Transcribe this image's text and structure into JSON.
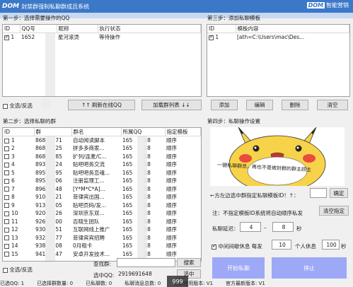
{
  "window": {
    "logo": "DOM",
    "title": "封禁群强制私聊群成员系统",
    "brand_box": "DOM",
    "brand_text": "智能营销"
  },
  "step1": {
    "title": "第一步：选择需要操作的QQ",
    "columns": [
      "ID",
      "QQ号",
      "昵称",
      "执行状态"
    ],
    "rows": [
      {
        "id": "1",
        "qq": "1652",
        "nick": "星河滚烫",
        "status": "等待操作",
        "checked": true
      }
    ],
    "select_all": "全选/反选",
    "refresh": "↑↑ 刷新在线QQ",
    "load_groups": "加载群列表 ↓↓"
  },
  "step3": {
    "title": "第三步：添加私聊模板",
    "columns": [
      "ID",
      "模板内容"
    ],
    "rows": [
      {
        "id": "1",
        "content": "[ath=C:\\Users\\mac\\Des...",
        "checked": true
      }
    ],
    "add": "添加",
    "edit": "编辑",
    "delete": "删除",
    "clear": "清空"
  },
  "step2": {
    "title": "第二步：选择私聊的群",
    "columns": [
      "ID",
      "群",
      "群名",
      "所属QQ",
      "指定模板"
    ],
    "rows": [
      {
        "id": "1",
        "g": "868",
        "g2": "71",
        "name": "自动阅读脚本",
        "qq": "165",
        "qq2": "18",
        "tpl": "顺序"
      },
      {
        "id": "2",
        "g": "868",
        "g2": "25",
        "name": "拼多多商家...",
        "qq": "165",
        "qq2": "18",
        "tpl": "顺序"
      },
      {
        "id": "3",
        "g": "868",
        "g2": "85",
        "name": "扩列/连麦/C...",
        "qq": "165",
        "qq2": "18",
        "tpl": "顺序"
      },
      {
        "id": "4",
        "g": "893",
        "g2": "24",
        "name": "贴吧吧务交流",
        "qq": "165",
        "qq2": "18",
        "tpl": "顺序"
      },
      {
        "id": "5",
        "g": "895",
        "g2": "95",
        "name": "贴吧吧务恋魂...",
        "qq": "165",
        "qq2": "18",
        "tpl": "顺序"
      },
      {
        "id": "6",
        "g": "895",
        "g2": "06",
        "name": "注册监理工...",
        "qq": "165",
        "qq2": "18",
        "tpl": "顺序"
      },
      {
        "id": "7",
        "g": "896",
        "g2": "48",
        "name": "[Y*M*C*A]...",
        "qq": "165",
        "qq2": "18",
        "tpl": "顺序"
      },
      {
        "id": "8",
        "g": "910",
        "g2": "21",
        "name": "菲律宾出国...",
        "qq": "165",
        "qq2": "18",
        "tpl": "顺序"
      },
      {
        "id": "9",
        "g": "913",
        "g2": "05",
        "name": "贴吧页码/发...",
        "qq": "165",
        "qq2": "18",
        "tpl": "顺序"
      },
      {
        "id": "10",
        "g": "920",
        "g2": "26",
        "name": "深圳京东双...",
        "qq": "165",
        "qq2": "18",
        "tpl": "顺序"
      },
      {
        "id": "11",
        "g": "926",
        "g2": "00",
        "name": "百晓生团队",
        "qq": "165",
        "qq2": "18",
        "tpl": "顺序"
      },
      {
        "id": "12",
        "g": "930",
        "g2": "51",
        "name": "互联网线上推广",
        "qq": "165",
        "qq2": "18",
        "tpl": "顺序"
      },
      {
        "id": "13",
        "g": "932",
        "g2": "77",
        "name": "菲律宾宾招聘",
        "qq": "165",
        "qq2": "18",
        "tpl": "顺序"
      },
      {
        "id": "14",
        "g": "938",
        "g2": "08",
        "name": "0月租卡",
        "qq": "165",
        "qq2": "18",
        "tpl": "顺序"
      },
      {
        "id": "15",
        "g": "941",
        "g2": "47",
        "name": "安卓开发技术...",
        "qq": "165",
        "qq2": "18",
        "tpl": "顺序"
      }
    ],
    "select_all": "全选/反选",
    "find_label": "查找群:",
    "find_button": "搜索",
    "selected_qq_label": "选中QQ:",
    "selected_qq_value": "2919691648",
    "select_button": "选中"
  },
  "step4": {
    "title": "第四步：私聊操作设置",
    "meme_caption": "一键私聊群员，再也不是被封群的群主顾主",
    "template_label": "←方左边选中群指定私聊模板ID！↑：",
    "confirm": "确定",
    "note": "注：不指定模板ID系统将自动顺序私发",
    "clear_assign": "清空指定",
    "delay_label": "私聊延迟：",
    "delay_min": "4",
    "dash": "–",
    "delay_max": "8",
    "seconds": "秒",
    "rest_label": "中间间歇休息 每发",
    "rest_count": "10",
    "rest_mid": "个人休息",
    "rest_seconds": "100",
    "rest_unit": "秒",
    "start": "开始私聊",
    "stop": "停止"
  },
  "status": {
    "online": "已选QQ: 1",
    "groups": "已选择群数量: 0",
    "sent": "已私聊数: 0",
    "messages": "私聊消息总数: 0",
    "version": "当前使用版本: V1",
    "latest": "官方最新版本: V1"
  },
  "overlay_number": "999",
  "colors": {
    "titlebar": "#3c78c8",
    "accent_button": "#9da8f6",
    "pikachu": "#f7d34a"
  }
}
